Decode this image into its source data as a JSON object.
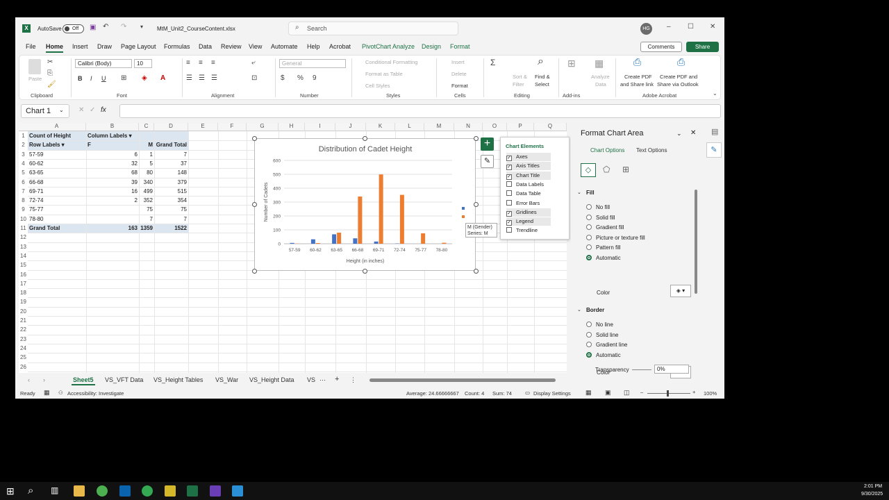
{
  "titlebar": {
    "autosave": "AutoSave",
    "toggle": "Off",
    "filename": "MtM_Unit2_CourseContent.xlsx",
    "search": "Search",
    "user_initials": "HG"
  },
  "menu": {
    "items": [
      "File",
      "Home",
      "Insert",
      "Draw",
      "Page Layout",
      "Formulas",
      "Data",
      "Review",
      "View",
      "Automate",
      "Help",
      "Acrobat",
      "PivotChart Analyze",
      "Design",
      "Format"
    ],
    "comments": "Comments",
    "share": "Share"
  },
  "ribbon": {
    "clipboard": {
      "label": "Clipboard",
      "paste": "Paste"
    },
    "font": {
      "label": "Font",
      "name": "Calibri (Body)",
      "size": "10"
    },
    "alignment": {
      "label": "Alignment"
    },
    "number": {
      "label": "Number",
      "format": "General"
    },
    "styles": {
      "label": "Styles",
      "cond": "Conditional Formatting",
      "table": "Format as Table",
      "cell": "Cell Styles"
    },
    "cells": {
      "label": "Cells",
      "insert": "Insert",
      "delete": "Delete",
      "format": "Format"
    },
    "editing": {
      "label": "Editing",
      "sort": "Sort &",
      "filter": "Filter",
      "find": "Find &",
      "select": "Select"
    },
    "addins": {
      "label": "Add-ins",
      "analyze": "Analyze",
      "data": "Data"
    },
    "acrobat": {
      "label": "Adobe Acrobat",
      "create1a": "Create PDF",
      "create1b": "and Share link",
      "create2a": "Create PDF and",
      "create2b": "Share via Outlook"
    }
  },
  "formula": {
    "namebox": "Chart 1",
    "fx": "fx"
  },
  "columns": [
    "A",
    "B",
    "C",
    "D",
    "E",
    "F",
    "G",
    "H",
    "I",
    "J",
    "K",
    "L",
    "M",
    "N",
    "O",
    "P",
    "Q"
  ],
  "rows": [
    "1",
    "2",
    "3",
    "4",
    "5",
    "6",
    "7",
    "8",
    "9",
    "10",
    "11",
    "12",
    "13",
    "14",
    "15",
    "16",
    "17",
    "18",
    "19",
    "20",
    "21",
    "22",
    "23",
    "24",
    "25",
    "26"
  ],
  "pivot": {
    "r1": {
      "a": "Count of Height",
      "b": "Column Labels"
    },
    "r2": {
      "a": "Row Labels",
      "b": "F",
      "c": "M",
      "d": "Grand Total"
    },
    "data": [
      {
        "a": "57-59",
        "b": "6",
        "c": "1",
        "d": "7"
      },
      {
        "a": "60-62",
        "b": "32",
        "c": "5",
        "d": "37"
      },
      {
        "a": "63-65",
        "b": "68",
        "c": "80",
        "d": "148"
      },
      {
        "a": "66-68",
        "b": "39",
        "c": "340",
        "d": "379"
      },
      {
        "a": "69-71",
        "b": "16",
        "c": "499",
        "d": "515"
      },
      {
        "a": "72-74",
        "b": "2",
        "c": "352",
        "d": "354"
      },
      {
        "a": "75-77",
        "b": "",
        "c": "75",
        "d": "75"
      },
      {
        "a": "78-80",
        "b": "",
        "c": "7",
        "d": "7"
      }
    ],
    "total": {
      "a": "Grand Total",
      "b": "163",
      "c": "1359",
      "d": "1522"
    }
  },
  "chart_data": {
    "type": "bar",
    "title": "Distribution of Cadet Height",
    "xlabel": "Height (in inches)",
    "ylabel": "Number of Cadets",
    "categories": [
      "57-59",
      "60-62",
      "63-65",
      "66-68",
      "69-71",
      "72-74",
      "75-77",
      "78-80"
    ],
    "series": [
      {
        "name": "F",
        "values": [
          6,
          32,
          68,
          39,
          16,
          2,
          0,
          0
        ],
        "color": "#4472c4"
      },
      {
        "name": "M",
        "values": [
          1,
          5,
          80,
          340,
          499,
          352,
          75,
          7
        ],
        "color": "#ed7d31"
      }
    ],
    "ylim": [
      0,
      600
    ],
    "yticks": [
      "0",
      "100",
      "200",
      "300",
      "400",
      "500",
      "600"
    ],
    "grid": true
  },
  "elements_popup": {
    "title": "Chart Elements",
    "items": [
      {
        "label": "Axes",
        "checked": "✓"
      },
      {
        "label": "Axis Titles",
        "checked": "✓"
      },
      {
        "label": "Chart Title",
        "checked": "✓"
      },
      {
        "label": "Data Labels",
        "checked": ""
      },
      {
        "label": "Data Table",
        "checked": ""
      },
      {
        "label": "Error Bars",
        "checked": ""
      },
      {
        "label": "Gridlines",
        "checked": "✓"
      },
      {
        "label": "Legend",
        "checked": "✓"
      },
      {
        "label": "Trendline",
        "checked": ""
      }
    ]
  },
  "tooltip": {
    "line1": "M (Gender)",
    "line2": "Series: M"
  },
  "pane": {
    "title": "Format Chart Area",
    "tab1": "Chart Options",
    "tab2": "Text Options",
    "fill": "Fill",
    "fill_opts": [
      "No fill",
      "Solid fill",
      "Gradient fill",
      "Picture or texture fill",
      "Pattern fill",
      "Automatic"
    ],
    "color": "Color",
    "border": "Border",
    "border_opts": [
      "No line",
      "Solid line",
      "Gradient line",
      "Automatic"
    ],
    "transparency": "Transparency",
    "transparency_val": "0%"
  },
  "sheets": [
    "Sheet5",
    "VS_VFT Data",
    "VS_Height Tables",
    "VS_War",
    "VS_Height Data",
    "VS"
  ],
  "status": {
    "ready": "Ready",
    "access": "Accessibility: Investigate",
    "average": "Average: 24.66666667",
    "count": "Count: 4",
    "sum": "Sum: 74",
    "display": "Display Settings",
    "zoom": "100%"
  },
  "clock": {
    "time": "2:01 PM",
    "date": "9/30/2025"
  }
}
